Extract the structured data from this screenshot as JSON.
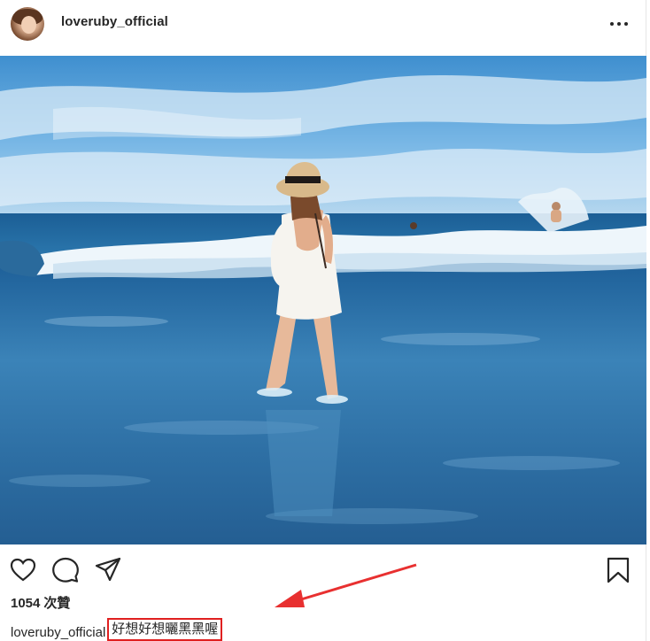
{
  "post": {
    "username": "loveruby_official",
    "image_alt": "woman in white dress and straw hat standing in ocean waves",
    "likes": {
      "count": "1054",
      "label": "次贊"
    },
    "caption": {
      "user": "loveruby_official",
      "text": "好想好想曬黑黑喔"
    }
  },
  "icons": {
    "more": "more-options-icon",
    "like": "heart-icon",
    "comment": "comment-icon",
    "share": "share-icon",
    "save": "bookmark-icon"
  },
  "colors": {
    "text": "#262626",
    "highlight_box": "#e02020",
    "arrow": "#e83030",
    "sky": "#5aa6da",
    "sea": "#2f6fa3"
  }
}
